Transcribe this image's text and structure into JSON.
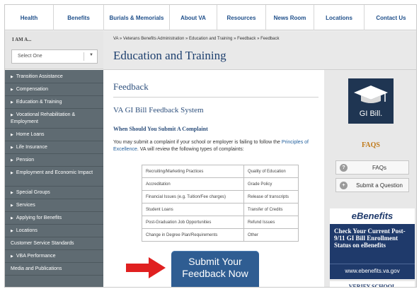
{
  "topnav": [
    "Health",
    "Benefits",
    "Burials & Memorials",
    "About VA",
    "Resources",
    "News Room",
    "Locations",
    "Contact Us"
  ],
  "iam": {
    "label": "I AM A...",
    "select_value": "Select One",
    "caret": "▼"
  },
  "leftnav": [
    "Transition Assistance",
    "Compensation",
    "Education & Training",
    "Vocational Rehabilitation & Employment",
    "Home Loans",
    "Life Insurance",
    "Pension",
    "Employment and Economic Impact",
    "Special Groups",
    "Services",
    "Applying for Benefits",
    "Locations",
    "Customer Service Standards",
    "VBA Performance",
    "Media and Publications"
  ],
  "breadcrumb": [
    "VA",
    "Veterans Benefits Administration",
    "Education and Training",
    "Feedback",
    "Feedback"
  ],
  "breadcrumb_sep": "»",
  "page_title": "Education and Training",
  "content": {
    "heading": "Feedback",
    "subheading": "VA GI Bill Feedback System",
    "section": "When Should You Submit A Complaint",
    "intro_before": "You may submit a complaint if your school or employer is failing to follow the ",
    "intro_link": "Principles of Excellence",
    "intro_after": ". VA will review the following types of complaints:",
    "complaints": [
      [
        "Recruiting/Marketing Practices",
        "Quality of Education"
      ],
      [
        "Accreditation",
        "Grade Policy"
      ],
      [
        "Financial Issues (e.g. Tuition/Fee charges)",
        "Release of transcripts"
      ],
      [
        "Student Loans",
        "Transfer of Credits"
      ],
      [
        "Post-Graduation Job Opportunities",
        "Refund Issues"
      ],
      [
        "Change in Degree Plan/Requirements",
        "Other"
      ]
    ],
    "submit_line1": "Submit Your",
    "submit_line2": "Feedback Now"
  },
  "sidebar": {
    "gibill_text": "GI Bill.",
    "faqs_title": "FAQS",
    "faqs_button": "FAQs",
    "faqs_icon": "?",
    "ask_button": "Submit a Question",
    "ask_icon": "+",
    "ebenefits_logo": "eBenefits",
    "ebenefits_text": "Check Your Current Post-9/11 GI Bill Enrollment Status on eBenefits",
    "ebenefits_url": "www.ebenefits.va.gov",
    "verify": "VERIFY SCHOOL"
  },
  "colors": {
    "nav_text": "#1f4f8a",
    "leftnav_bg": "#5f6b72",
    "title": "#1d3f6e",
    "submit_button": "#2f5d92",
    "arrow": "#e02020",
    "faqs_title": "#c07a1a",
    "ebenefits_bg": "#1f3a6b"
  }
}
